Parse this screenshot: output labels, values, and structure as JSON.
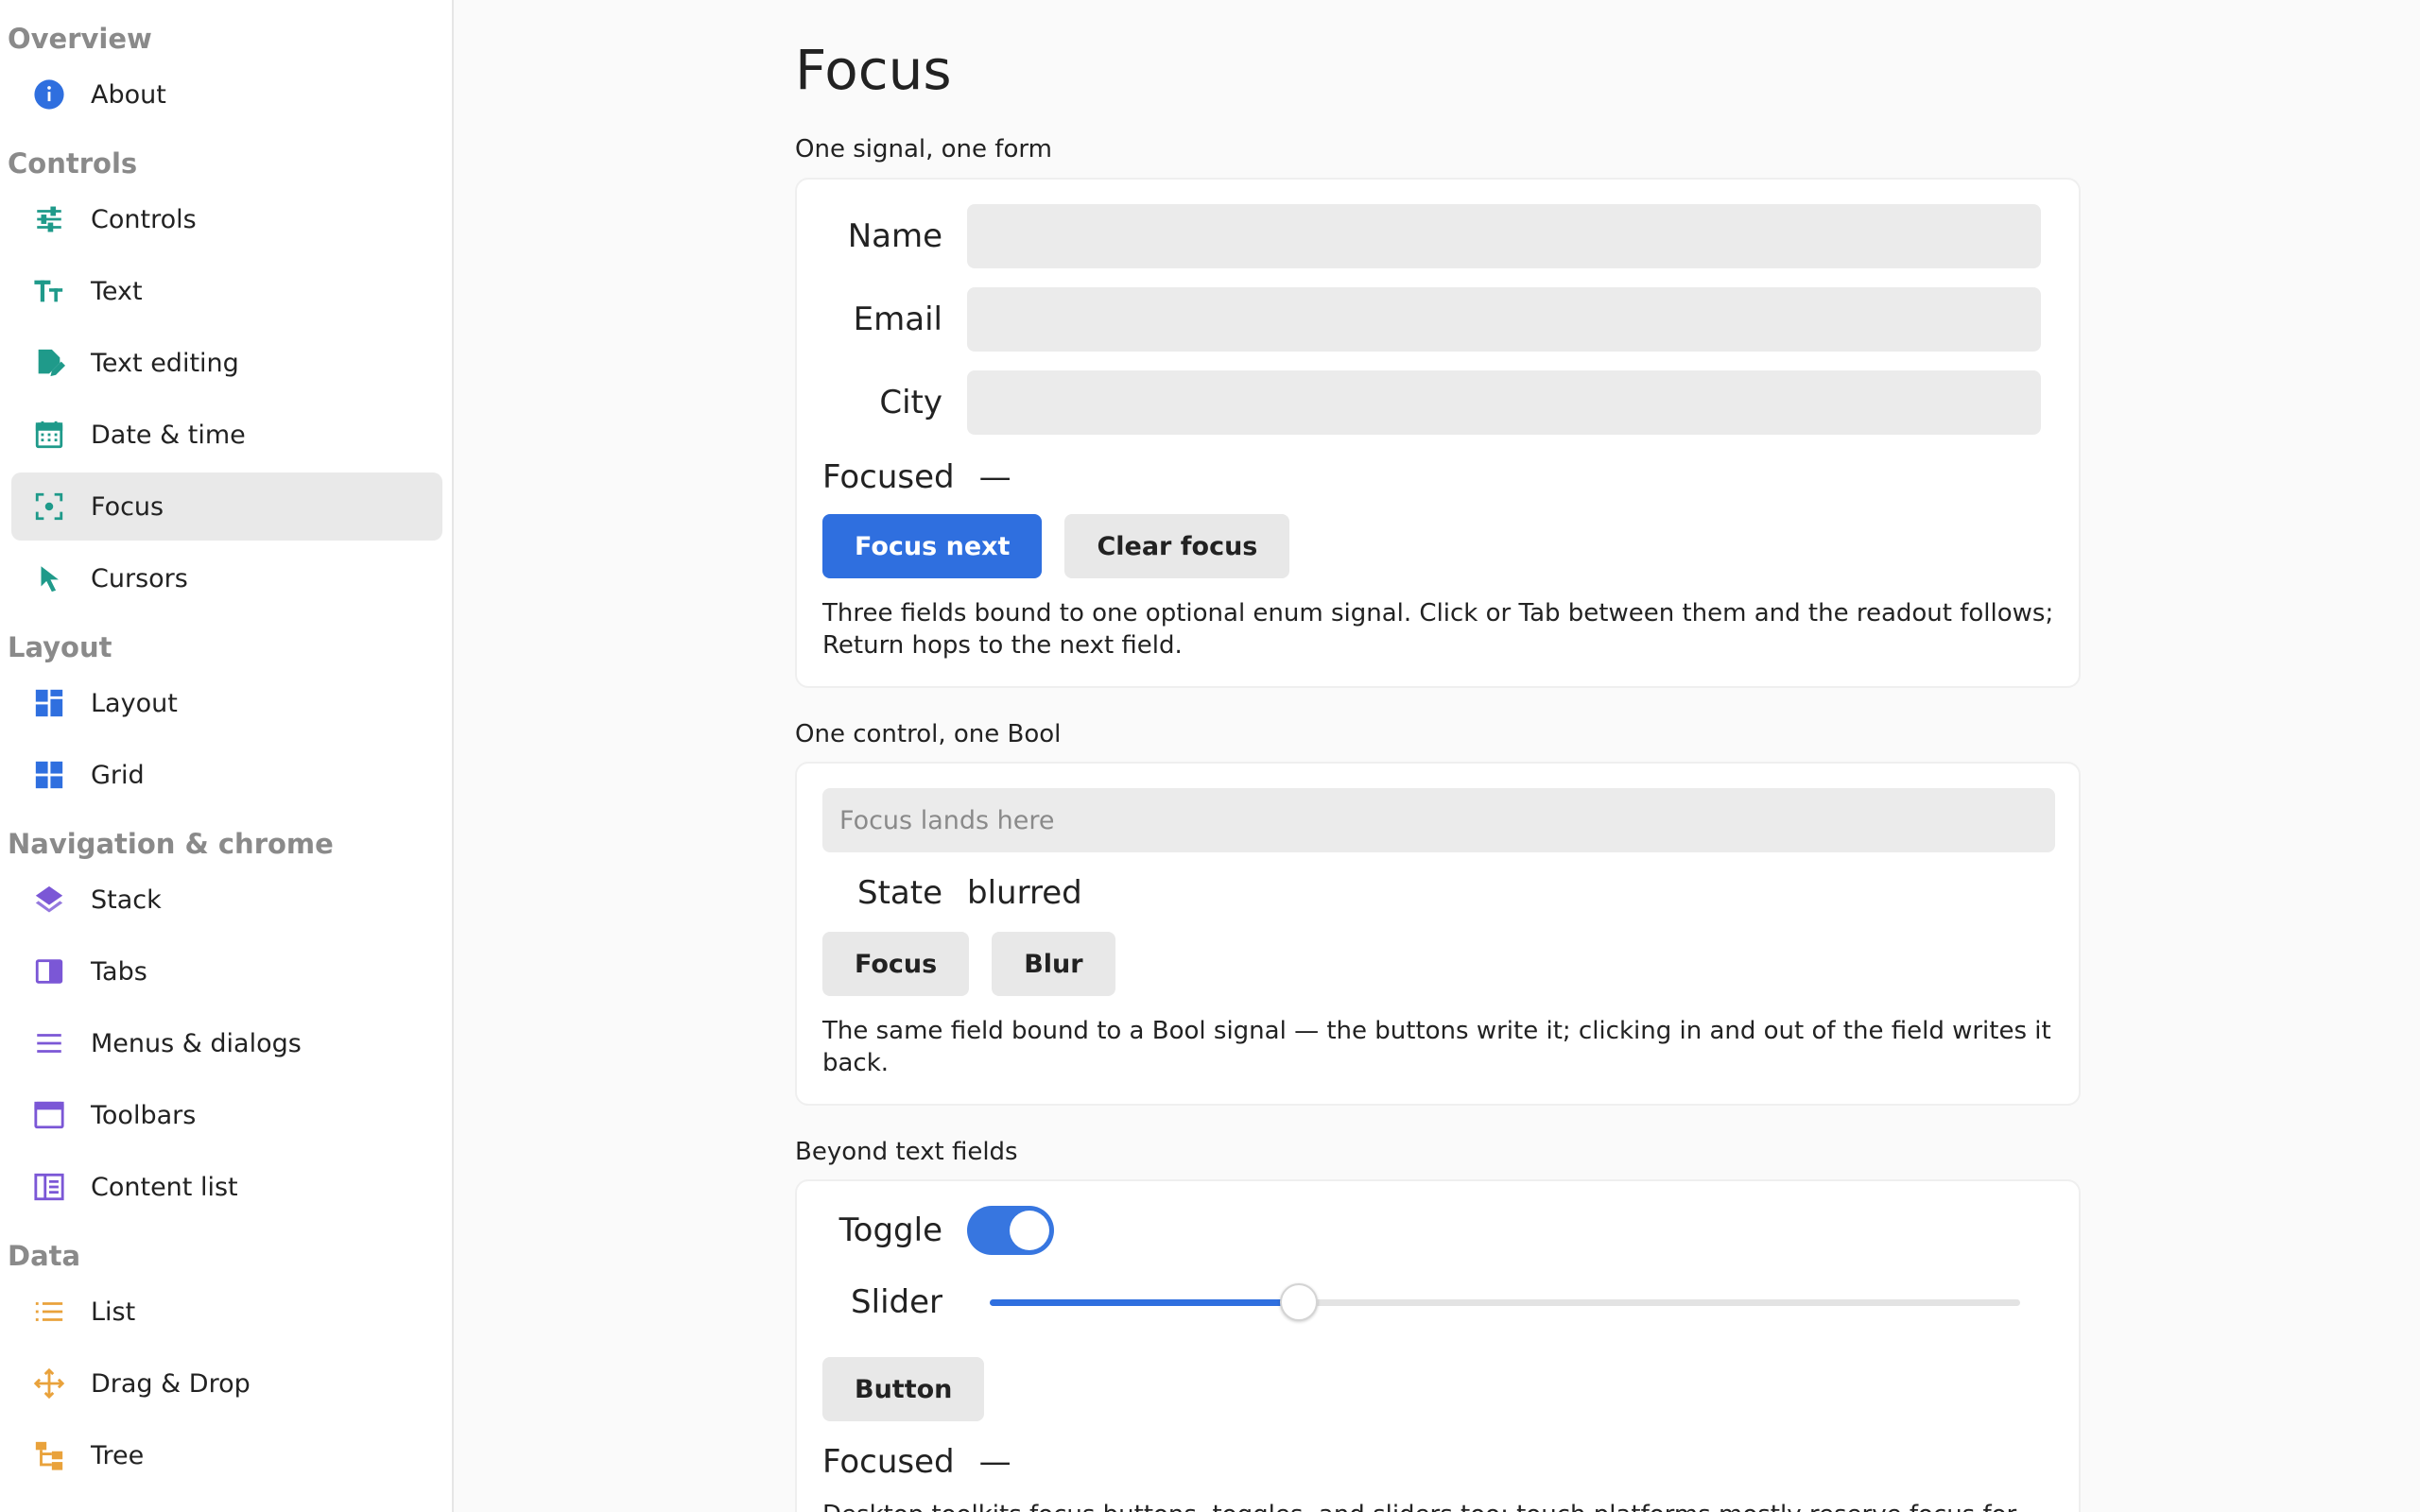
{
  "sidebar": {
    "sections": [
      {
        "title": "Overview",
        "items": [
          {
            "label": "About",
            "icon": "info-icon",
            "color": "#2f6fdf"
          }
        ]
      },
      {
        "title": "Controls",
        "items": [
          {
            "label": "Controls",
            "icon": "sliders-icon",
            "color": "#1f9a8a"
          },
          {
            "label": "Text",
            "icon": "text-size-icon",
            "color": "#1f9a8a"
          },
          {
            "label": "Text editing",
            "icon": "edit-document-icon",
            "color": "#1f9a8a"
          },
          {
            "label": "Date & time",
            "icon": "calendar-icon",
            "color": "#1f9a8a"
          },
          {
            "label": "Focus",
            "icon": "focus-target-icon",
            "color": "#1f9a8a",
            "active": true
          },
          {
            "label": "Cursors",
            "icon": "cursor-arrow-icon",
            "color": "#1f9a8a"
          }
        ]
      },
      {
        "title": "Layout",
        "items": [
          {
            "label": "Layout",
            "icon": "layout-grid-icon",
            "color": "#2f6fdf"
          },
          {
            "label": "Grid",
            "icon": "grid-icon",
            "color": "#2f6fdf"
          }
        ]
      },
      {
        "title": "Navigation & chrome",
        "items": [
          {
            "label": "Stack",
            "icon": "layers-icon",
            "color": "#7b57d6"
          },
          {
            "label": "Tabs",
            "icon": "tab-icon",
            "color": "#7b57d6"
          },
          {
            "label": "Menus & dialogs",
            "icon": "menu-lines-icon",
            "color": "#7b57d6"
          },
          {
            "label": "Toolbars",
            "icon": "window-icon",
            "color": "#7b57d6"
          },
          {
            "label": "Content list",
            "icon": "content-list-icon",
            "color": "#7b57d6"
          }
        ]
      },
      {
        "title": "Data",
        "items": [
          {
            "label": "List",
            "icon": "list-icon",
            "color": "#e9a23b"
          },
          {
            "label": "Drag & Drop",
            "icon": "move-arrows-icon",
            "color": "#e9a23b"
          },
          {
            "label": "Tree",
            "icon": "tree-icon",
            "color": "#e9a23b"
          }
        ]
      }
    ]
  },
  "main": {
    "title": "Focus",
    "form_group": {
      "label": "One signal, one form",
      "fields": [
        {
          "label": "Name",
          "value": ""
        },
        {
          "label": "Email",
          "value": ""
        },
        {
          "label": "City",
          "value": ""
        }
      ],
      "focused_label": "Focused",
      "focused_value": "—",
      "focus_next_label": "Focus next",
      "clear_focus_label": "Clear focus",
      "description": "Three fields bound to one optional enum signal. Click or Tab between them and the readout follows; Return hops to the next field."
    },
    "bool_group": {
      "label": "One control, one Bool",
      "field_placeholder": "Focus lands here",
      "state_label": "State",
      "state_value": "blurred",
      "focus_label": "Focus",
      "blur_label": "Blur",
      "description": "The same field bound to a Bool signal — the buttons write it; clicking in and out of the field writes it back."
    },
    "beyond_group": {
      "label": "Beyond text fields",
      "toggle_label": "Toggle",
      "toggle_on": true,
      "slider_label": "Slider",
      "slider_value": 0.3,
      "button_label": "Button",
      "focused_label": "Focused",
      "focused_value": "—",
      "description": "Desktop toolkits focus buttons, toggles, and sliders too; touch platforms mostly reserve focus for"
    }
  }
}
